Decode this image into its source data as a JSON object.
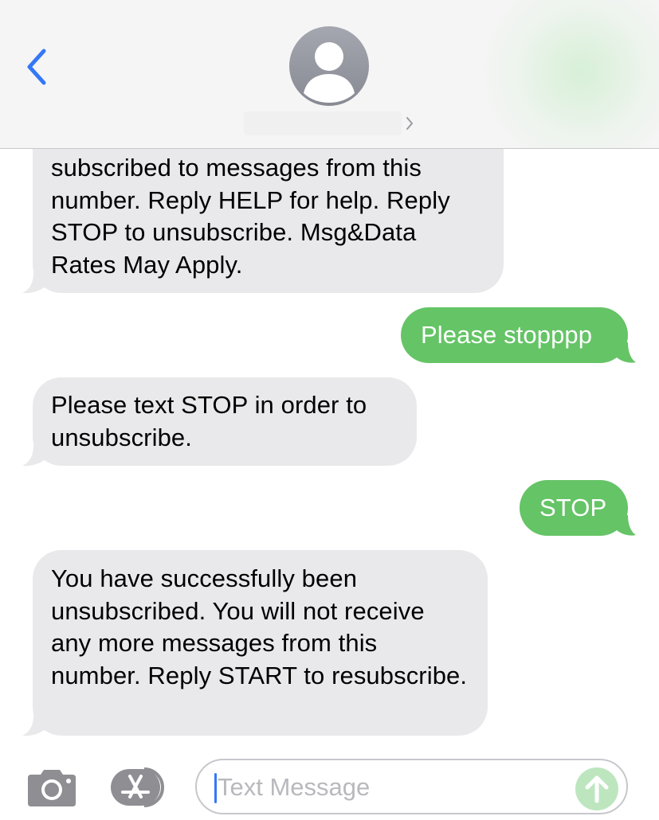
{
  "header": {
    "contact_name": ""
  },
  "messages": [
    {
      "direction": "received",
      "text": "subscribed to messages from this number. Reply HELP for help. Reply STOP to unsubscribe. Msg&Data Rates May Apply."
    },
    {
      "direction": "sent",
      "text": "Please stopppp"
    },
    {
      "direction": "received",
      "text": "Please text STOP in order to unsubscribe."
    },
    {
      "direction": "sent",
      "text": "STOP"
    },
    {
      "direction": "received",
      "text": "You have successfully been unsubscribed. You will not receive any more messages from this number. Reply START to resubscribe."
    }
  ],
  "input_bar": {
    "placeholder": "Text Message",
    "value": ""
  },
  "icons": {
    "back": "chevron-left-icon",
    "avatar": "person-icon",
    "contact_details": "chevron-right-icon",
    "camera": "camera-icon",
    "app_store": "app-store-icon",
    "send": "arrow-up-icon"
  },
  "colors": {
    "accent_blue": "#3478f6",
    "sent_bubble": "#65c466",
    "received_bubble": "#e9e9eb",
    "header_background": "#f5f5f5",
    "send_button_disabled": "#bde6bf"
  }
}
